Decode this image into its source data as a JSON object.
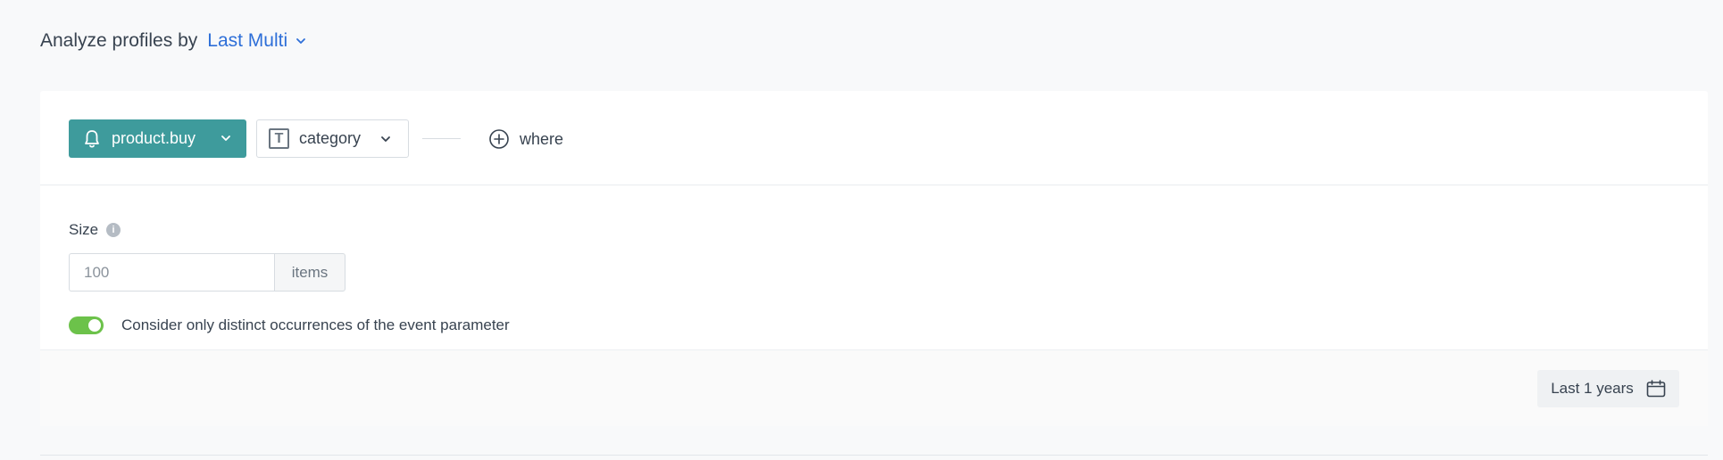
{
  "header": {
    "label": "Analyze profiles by",
    "selector_value": "Last Multi"
  },
  "event": {
    "name": "product.buy",
    "icon": "bell-icon",
    "color": "#3e9b9c"
  },
  "parameter": {
    "name": "category",
    "type_icon": "text-type-icon",
    "type_glyph": "T"
  },
  "where": {
    "label": "where"
  },
  "size": {
    "label": "Size",
    "info_glyph": "i",
    "placeholder": "100",
    "suffix": "items"
  },
  "distinct_toggle": {
    "label": "Consider only distinct occurrences of the event parameter",
    "enabled": true,
    "color": "#6cc24a"
  },
  "footer": {
    "date_range": "Last 1 years"
  },
  "colors": {
    "accent": "#2e6fd8",
    "background": "#f8f9fa",
    "text": "#384350"
  }
}
